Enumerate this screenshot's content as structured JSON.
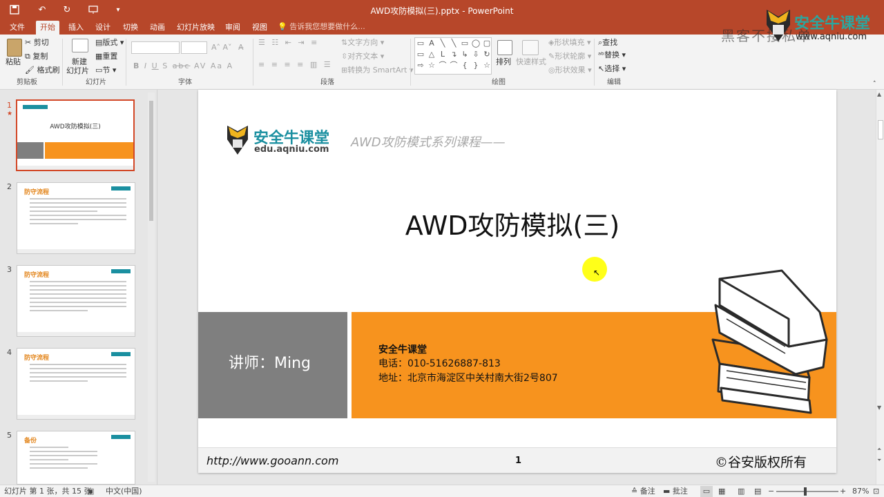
{
  "window": {
    "title": "AWD攻防模拟(三).pptx - PowerPoint"
  },
  "qat": {
    "undo_icon": "↶",
    "redo_icon": "↻"
  },
  "tabs": [
    "文件",
    "开始",
    "插入",
    "设计",
    "切换",
    "动画",
    "幻灯片放映",
    "审阅",
    "视图"
  ],
  "tell_me": "告诉我您想要做什么...",
  "ribbon": {
    "clipboard": {
      "paste": "粘贴",
      "cut": "剪切",
      "copy": "复制",
      "format_painter": "格式刷",
      "label": "剪贴板"
    },
    "slides": {
      "new_slide_1": "新建",
      "new_slide_2": "幻灯片",
      "layout": "版式",
      "reset": "重置",
      "section": "节",
      "label": "幻灯片"
    },
    "font": {
      "label": "字体",
      "buttons": [
        "B",
        "I",
        "U",
        "S",
        "abc",
        "AV",
        "Aa",
        "A"
      ]
    },
    "paragraph": {
      "text_direction": "文字方向",
      "align_text": "对齐文本",
      "smartart": "转换为 SmartArt",
      "label": "段落"
    },
    "drawing": {
      "arrange": "排列",
      "quick_styles": "快速样式",
      "shape_fill": "形状填充",
      "shape_outline": "形状轮廓",
      "shape_effects": "形状效果",
      "label": "绘图",
      "shapes": [
        "▭",
        "A",
        "╲",
        "╲",
        "▭",
        "◯",
        "▢",
        "▭",
        "△",
        "L",
        "↴",
        "↳",
        "⇩",
        "↻",
        "⇨",
        "☆",
        "⌒",
        "⌒",
        "{",
        "}",
        "☆"
      ]
    },
    "editing": {
      "find": "查找",
      "replace": "替换",
      "select": "选择",
      "label": "编辑"
    }
  },
  "thumbnails": [
    {
      "num": "1",
      "title": "AWD攻防模拟(三)"
    },
    {
      "num": "2",
      "title": "防守流程"
    },
    {
      "num": "3",
      "title": "防守流程"
    },
    {
      "num": "4",
      "title": "防守流程"
    },
    {
      "num": "5",
      "title": "备份"
    }
  ],
  "slide": {
    "brand_name": "安全牛课堂",
    "brand_url": "edu.aqniu.com",
    "series": "AWD攻防模式系列课程——",
    "title": "AWD攻防模拟(三)",
    "lecturer": "讲师：Ming",
    "org": "安全牛课堂",
    "phone": "电话：010-51626887-813",
    "address": "地址：北京市海淀区中关村南大街2号807",
    "footer_url": "http://www.gooann.com",
    "page_number": "1",
    "copyright": "©谷安版权所有"
  },
  "watermark": {
    "text1": "黑客不接私单",
    "brand": "安全牛课堂",
    "url": "www.aqniu.com"
  },
  "statusbar": {
    "slide_info": "幻灯片 第 1 张，共 15 张",
    "language": "中文(中国)",
    "notes": "备注",
    "comments": "批注",
    "zoom": "87%"
  },
  "colors": {
    "accent": "#b7472a",
    "orange": "#f7931e",
    "gray_block": "#7f7f7f",
    "teal": "#1a8fa0",
    "cursor": "#ffff00"
  }
}
